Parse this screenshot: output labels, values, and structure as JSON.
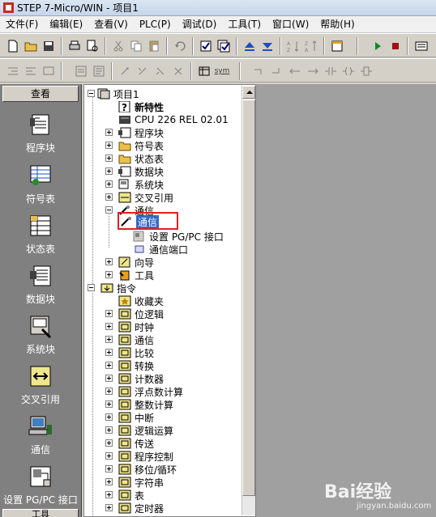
{
  "window": {
    "title": "STEP 7-Micro/WIN - 项目1"
  },
  "menu": [
    "文件(F)",
    "编辑(E)",
    "查看(V)",
    "PLC(P)",
    "调试(D)",
    "工具(T)",
    "窗口(W)",
    "帮助(H)"
  ],
  "toolbar2": {
    "sym_label": "sym"
  },
  "nav": {
    "header": "查看",
    "items": [
      {
        "label": "程序块",
        "icon": "program-block-icon"
      },
      {
        "label": "符号表",
        "icon": "symbol-table-icon"
      },
      {
        "label": "状态表",
        "icon": "status-table-icon"
      },
      {
        "label": "数据块",
        "icon": "data-block-icon"
      },
      {
        "label": "系统块",
        "icon": "system-block-icon"
      },
      {
        "label": "交叉引用",
        "icon": "cross-reference-icon"
      },
      {
        "label": "通信",
        "icon": "communication-icon"
      },
      {
        "label": "设置 PG/PC 接口",
        "icon": "pgpc-interface-icon"
      }
    ],
    "footer": "工具"
  },
  "tree": {
    "project": "项目1",
    "new_features": "新特性",
    "cpu": "CPU 226 REL 02.01",
    "folders": [
      "程序块",
      "符号表",
      "状态表",
      "数据块",
      "系统块",
      "交叉引用"
    ],
    "comm": "通信",
    "comm_children": [
      "通信",
      "设置 PG/PC 接口",
      "通信端口"
    ],
    "after_comm": [
      "向导",
      "工具"
    ],
    "instructions": "指令",
    "favorites": "收藏夹",
    "instruction_groups": [
      "位逻辑",
      "时钟",
      "通信",
      "比较",
      "转换",
      "计数器",
      "浮点数计算",
      "整数计算",
      "中断",
      "逻辑运算",
      "传送",
      "程序控制",
      "移位/循环",
      "字符串",
      "表",
      "定时器"
    ]
  },
  "watermark": {
    "brand": "Bai经验",
    "url": "jingyan.baidu.com"
  }
}
